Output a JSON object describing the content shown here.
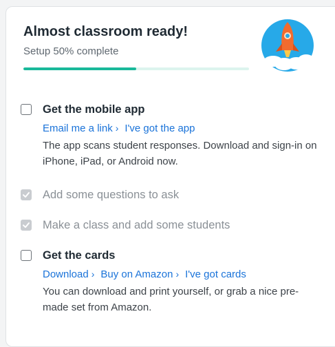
{
  "header": {
    "title": "Almost classroom ready!",
    "subtitle": "Setup 50% complete",
    "progress": 0.5,
    "accent": "#19b99a",
    "illustration_icon": "rocket-icon"
  },
  "tasks": [
    {
      "title": "Get the mobile app",
      "checked": false,
      "links": [
        "Email me a link",
        "I've got the app"
      ],
      "description": "The app scans student responses. Download and sign-in on iPhone, iPad, or Android now."
    },
    {
      "title": "Add some questions to ask",
      "checked": true
    },
    {
      "title": "Make a class and add some students",
      "checked": true
    },
    {
      "title": "Get the cards",
      "checked": false,
      "links": [
        "Download",
        "Buy on Amazon",
        "I've got cards"
      ],
      "description": "You can download and print yourself, or grab a nice pre-made set from Amazon."
    }
  ],
  "colors": {
    "link": "#1a73d9",
    "checked_box": "#c9ccd0",
    "muted_text": "#8a9096"
  }
}
